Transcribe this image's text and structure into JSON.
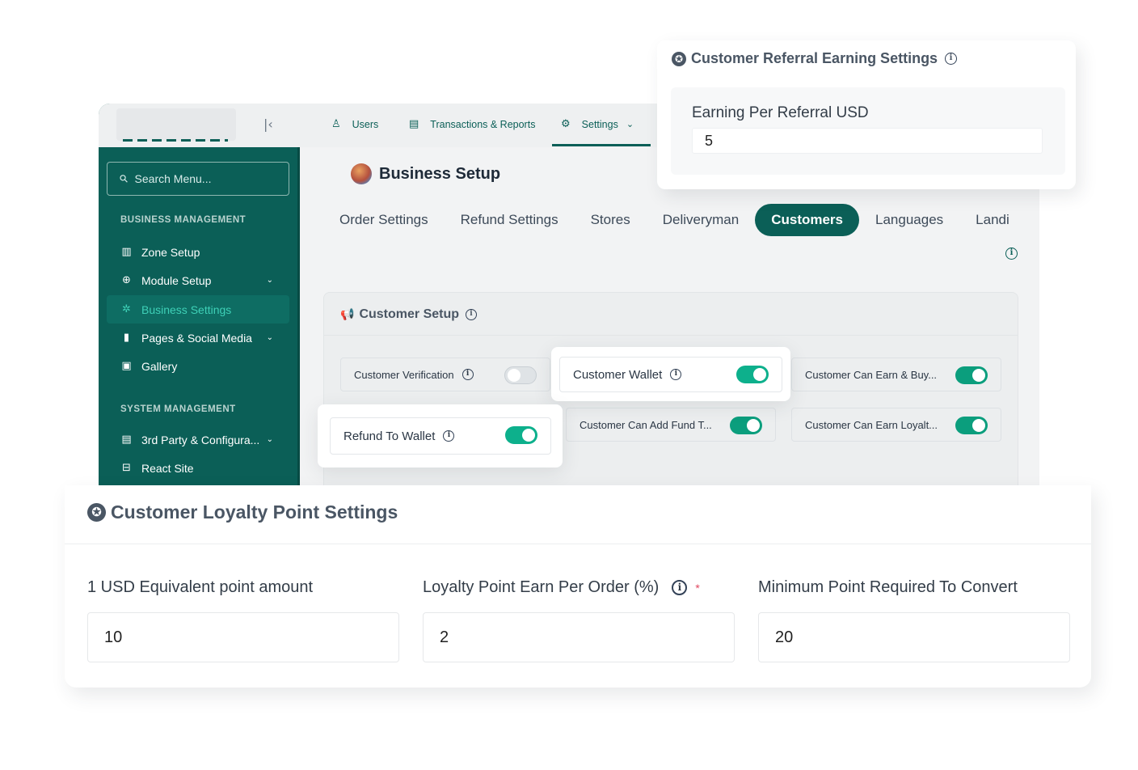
{
  "topnav": {
    "users": "Users",
    "transactions": "Transactions & Reports",
    "settings": "Settings"
  },
  "sidebar": {
    "search_placeholder": "Search Menu...",
    "section1": "BUSINESS MANAGEMENT",
    "section2": "SYSTEM MANAGEMENT",
    "items": [
      {
        "label": "Zone Setup",
        "icon": "building-icon"
      },
      {
        "label": "Module Setup",
        "icon": "globe-icon"
      },
      {
        "label": "Business Settings",
        "icon": "gear-icon"
      },
      {
        "label": "Pages & Social Media",
        "icon": "pages-icon"
      },
      {
        "label": "Gallery",
        "icon": "gallery-icon"
      },
      {
        "label": "3rd Party & Configura...",
        "icon": "config-icon"
      },
      {
        "label": "React Site",
        "icon": "react-site-icon"
      }
    ]
  },
  "page": {
    "title": "Business Setup",
    "tabs": [
      "Order Settings",
      "Refund Settings",
      "Stores",
      "Deliveryman",
      "Customers",
      "Languages",
      "Landi"
    ],
    "active_tab": "Customers"
  },
  "customer_setup": {
    "title": "Customer Setup",
    "toggles": [
      {
        "label": "Customer Verification",
        "on": false
      },
      {
        "label": "Customer Wallet",
        "on": true
      },
      {
        "label": "Customer Can Earn & Buy...",
        "on": true
      },
      {
        "label": "Refund To Wallet",
        "on": true
      },
      {
        "label": "Customer Can Add Fund T...",
        "on": true
      },
      {
        "label": "Customer Can Earn Loyalt...",
        "on": true
      }
    ]
  },
  "referral": {
    "title": "Customer Referral Earning Settings",
    "label": "Earning Per Referral USD",
    "value": "5"
  },
  "loyalty": {
    "title": "Customer Loyalty Point Settings",
    "fields": [
      {
        "label": "1 USD Equivalent point amount",
        "value": "10"
      },
      {
        "label": "Loyalty Point Earn Per Order (%)",
        "value": "2",
        "required_mark": "*"
      },
      {
        "label": "Minimum Point Required To Convert",
        "value": "20"
      }
    ]
  },
  "colors": {
    "brand": "#0b5f57",
    "toggle_on": "#0b9e7d",
    "active_link": "#3ed0b7"
  }
}
